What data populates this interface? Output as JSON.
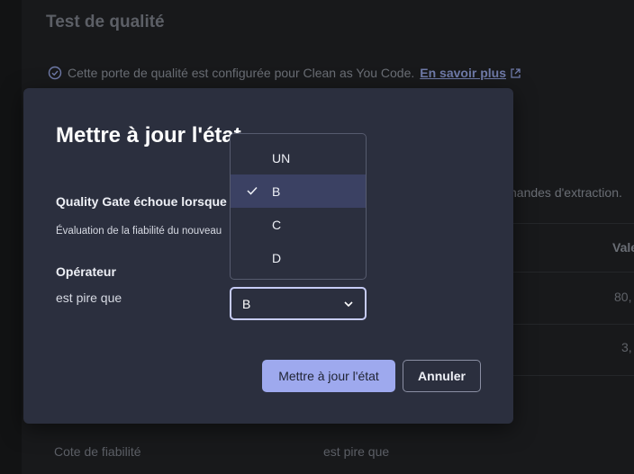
{
  "background": {
    "page_title": "Test de qualité",
    "info_text": "Cette porte de qualité est configurée pour Clean as You Code.",
    "info_link": "En savoir plus",
    "cut_text": "nandes d'extraction.",
    "column_head": "Vale",
    "values": [
      "80,",
      "3,"
    ],
    "bottom_row_label": "Cote de fiabilité",
    "bottom_row_operator": "est pire que"
  },
  "modal": {
    "title": "Mettre à jour l'état",
    "fail_label": "Quality Gate échoue lorsque",
    "metric_text": "Évaluation de la fiabilité du nouveau",
    "operator_label": "Opérateur",
    "operator_value": "est pire que",
    "select_value": "B",
    "options": [
      {
        "label": "UN",
        "selected": false
      },
      {
        "label": "B",
        "selected": true
      },
      {
        "label": "C",
        "selected": false
      },
      {
        "label": "D",
        "selected": false
      }
    ],
    "primary_button": "Mettre à jour l'état",
    "secondary_button": "Annuler"
  },
  "colors": {
    "modal_bg": "#2b2f3e",
    "accent": "#9ea9ee",
    "selected_option_bg": "#3b4163"
  }
}
